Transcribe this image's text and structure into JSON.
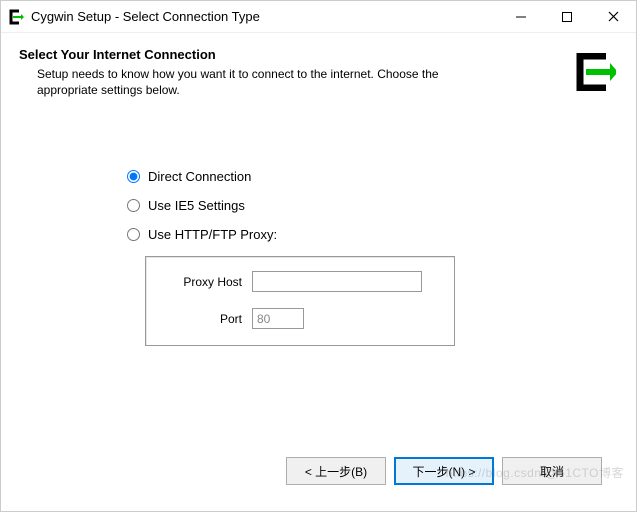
{
  "window": {
    "title": "Cygwin Setup - Select Connection Type"
  },
  "header": {
    "heading": "Select Your Internet Connection",
    "subtext": "Setup needs to know how you want it to connect to the internet.  Choose the appropriate settings below."
  },
  "options": {
    "direct": {
      "label": "Direct Connection",
      "selected": true
    },
    "ie5": {
      "label": "Use IE5 Settings",
      "selected": false
    },
    "proxy": {
      "label": "Use HTTP/FTP Proxy:",
      "selected": false
    }
  },
  "proxy": {
    "host_label": "Proxy Host",
    "host_value": "",
    "port_label": "Port",
    "port_value": "80",
    "enabled": false
  },
  "buttons": {
    "back": "< 上一步(B)",
    "next": "下一步(N) >",
    "cancel": "取消"
  },
  "watermark": "https://blog.csdn.@51CTO博客"
}
